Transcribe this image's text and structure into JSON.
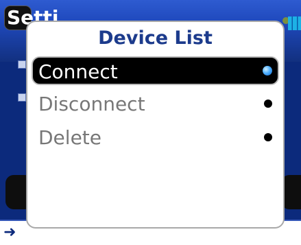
{
  "background": {
    "title": "Setti",
    "footer_arrow": "➜"
  },
  "popup": {
    "title": "Device List",
    "items": [
      {
        "label": "Connect",
        "selected": true
      },
      {
        "label": "Disconnect",
        "selected": false
      },
      {
        "label": "Delete",
        "selected": false
      }
    ]
  },
  "colors": {
    "title_blue": "#1c3b8c",
    "selected_bg": "#000000",
    "radio_selected": "#4fb0ff",
    "item_text": "#777777"
  }
}
